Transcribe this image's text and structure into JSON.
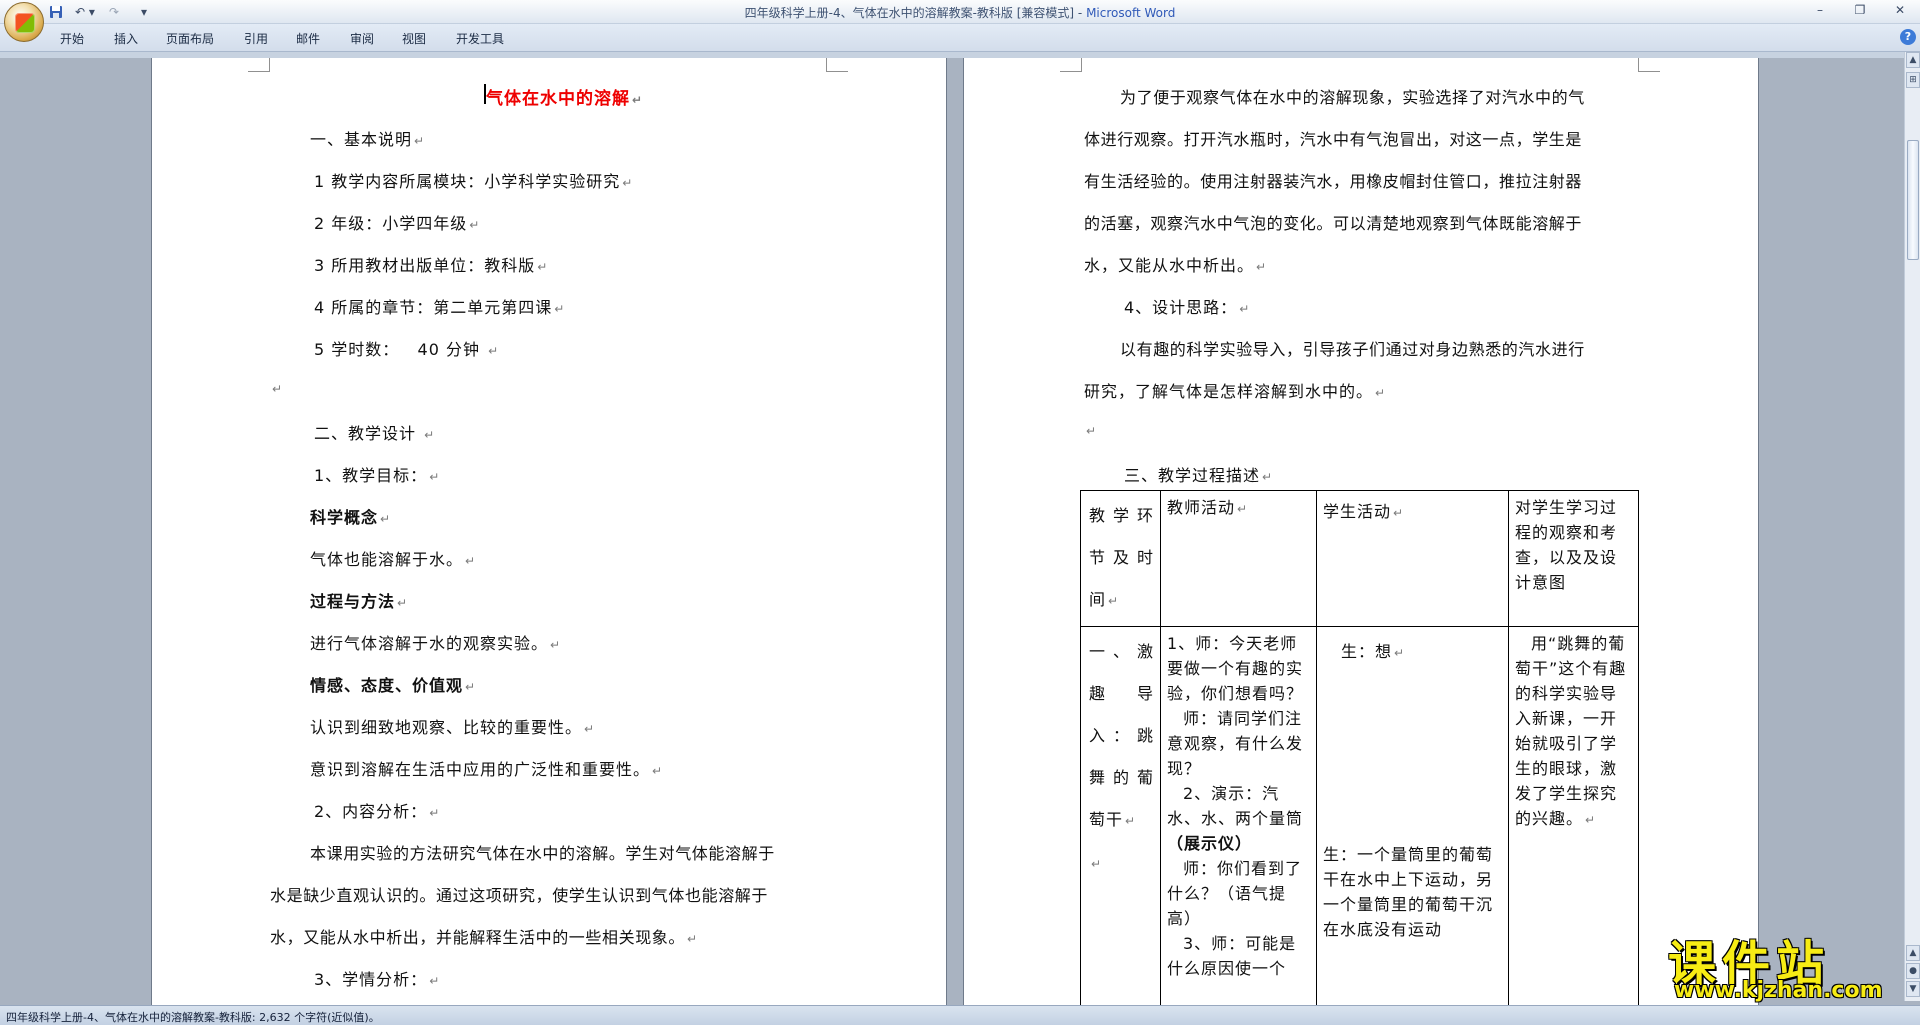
{
  "window": {
    "title": "四年级科学上册-4、气体在水中的溶解教案-教科版 [兼容模式] - ",
    "app_name": "Microsoft Word",
    "minimize": "–",
    "maximize": "❐",
    "close": "✕"
  },
  "qat": {
    "save_icon": "save-icon",
    "undo": "↶ ▾",
    "redo": "↷",
    "customize": "▾"
  },
  "ribbon": {
    "tabs": [
      "开始",
      "插入",
      "页面布局",
      "引用",
      "邮件",
      "审阅",
      "视图",
      "开发工具"
    ],
    "help": "?"
  },
  "page1": {
    "title": "气体在水中的溶解",
    "lines": [
      "一、基本说明",
      "1 教学内容所属模块：小学科学实验研究",
      "2 年级：小学四年级",
      "3 所用教材出版单位：教科版",
      "4 所属的章节：第二单元第四课",
      "5 学时数：   40 分钟 ",
      "",
      "二、教学设计 ",
      "1、教学目标：",
      "科学概念",
      "气体也能溶解于水。",
      "过程与方法",
      "进行气体溶解于水的观察实验。",
      "情感、态度、价值观",
      "认识到细致地观察、比较的重要性。",
      "意识到溶解在生活中应用的广泛性和重要性。",
      "2、内容分析：",
      "本课用实验的方法研究气体在水中的溶解。学生对气体能溶解于",
      "水是缺少直观认识的。通过这项研究，使学生认识到气体也能溶解于",
      "水，又能从水中析出，并能解释生活中的一些相关现象。",
      "3、学情分析："
    ]
  },
  "page2": {
    "lines": [
      "为了便于观察气体在水中的溶解现象，实验选择了对汽水中的气",
      "体进行观察。打开汽水瓶时，汽水中有气泡冒出，对这一点，学生是",
      "有生活经验的。使用注射器装汽水，用橡皮帽封住管口，推拉注射器",
      "的活塞，观察汽水中气泡的变化。可以清楚地观察到气体既能溶解于",
      "水，又能从水中析出。",
      "4、设计思路：",
      "以有趣的科学实验导入，引导孩子们通过对身边熟悉的汽水进行",
      "研究，了解气体是怎样溶解到水中的。",
      "",
      "三、教学过程描述"
    ],
    "table": {
      "headers": [
        "教学环节及时间",
        "教师活动",
        "学生活动",
        "对学生学习过程的观察和考查，以及及设计意图"
      ],
      "row": {
        "stage": "一、激趣导入：跳舞的葡萄干",
        "teacher": [
          "1、师：今天老师要做一个有趣的实验，你们想看吗？",
          "师：请同学们注意观察，有什么发现？",
          "2、演示：汽水、水、两个量筒（展示仪）",
          "师：你们看到了什么？（语气提高）",
          "3、师：可能是什么原因使一个"
        ],
        "teacher_bold": "（展示仪）",
        "student_1": "生：想",
        "student_2": "生：一个量筒里的葡萄干在水中上下运动，另一个量筒里的葡萄干沉在水底没有运动",
        "notes": "用“跳舞的葡萄干”这个有趣的科学实验导入新课，一开始就吸引了学生的眼球，激发了学生探究的兴趣。"
      }
    }
  },
  "status": {
    "text": "四年级科学上册-4、气体在水中的溶解教案-教科版: 2,632 个字符(近似值)。"
  },
  "watermark": {
    "title": "课件站",
    "url": "www.kjzhan.com"
  },
  "scrollbar": {
    "up": "▲",
    "down": "▼",
    "prev": "▲",
    "next": "▼"
  },
  "paragraph_mark": "↵"
}
